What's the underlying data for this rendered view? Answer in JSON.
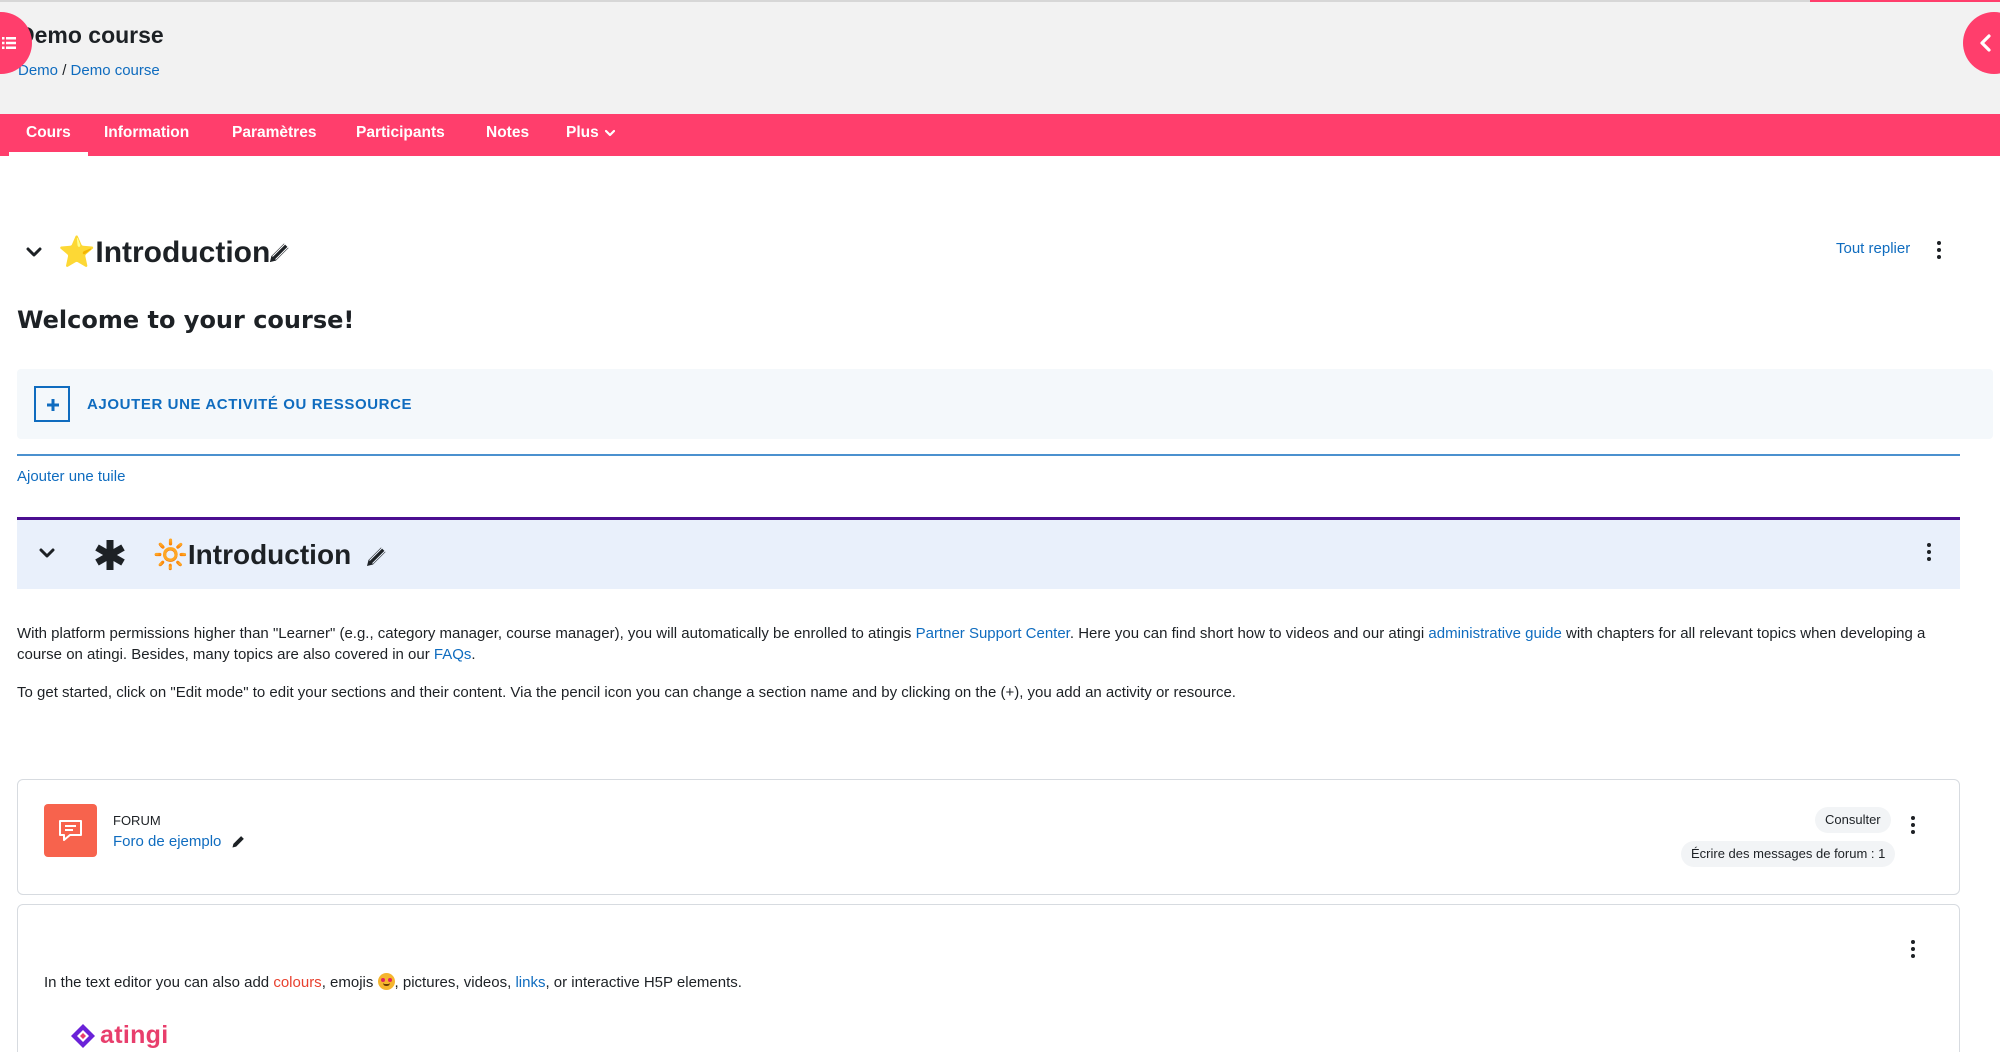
{
  "header": {
    "title": "Demo course",
    "breadcrumb": [
      "Demo",
      "Demo course"
    ],
    "breadcrumb_separator": "/"
  },
  "nav": {
    "tabs": [
      {
        "label": "Cours",
        "active": true
      },
      {
        "label": "Information"
      },
      {
        "label": "Paramètres"
      },
      {
        "label": "Participants"
      },
      {
        "label": "Notes"
      },
      {
        "label": "Plus",
        "dropdown": true
      }
    ]
  },
  "section1": {
    "emoji": "⭐",
    "title": "Introduction",
    "collapse_all": "Tout replier",
    "welcome": "Welcome to your course!",
    "add_activity": "AJOUTER UNE ACTIVITÉ OU RESSOURCE",
    "add_tile": "Ajouter une tuile"
  },
  "section2": {
    "emoji": "🔆",
    "title": "Introduction",
    "para1": {
      "t1": "With platform permissions higher than \"Learner\" (e.g., category manager, course manager), you will automatically be enrolled to atingis ",
      "link1": "Partner Support Center",
      "t2": ". Here you can find short how to videos and our atingi ",
      "link2": "administrative guide",
      "t3": " with chapters for all relevant topics when developing a course on atingi. Besides, many topics are also covered in our ",
      "link3": "FAQs",
      "t4": "."
    },
    "para2": "To get started, click on \"Edit mode\" to edit your sections and their content. Via the pencil icon you can change a section name and by clicking on the (+), you add an activity or resource."
  },
  "forum_card": {
    "type": "FORUM",
    "name": "Foro de ejemplo",
    "view_badge": "Consulter",
    "completion_badge": "Écrire des messages de forum : 1"
  },
  "text_card": {
    "t1": "In the text editor you can also add ",
    "colours": "colours",
    "t2": ", emojis ",
    "t3": ", pictures, videos, ",
    "links": "links",
    "t4": ", or interactive H5P elements.",
    "logo_text": "atingi"
  },
  "colors": {
    "brand": "#ff3e6c",
    "link": "#0f6cbf",
    "section_border": "#4b0f91",
    "forum_icon": "#f7634d"
  }
}
